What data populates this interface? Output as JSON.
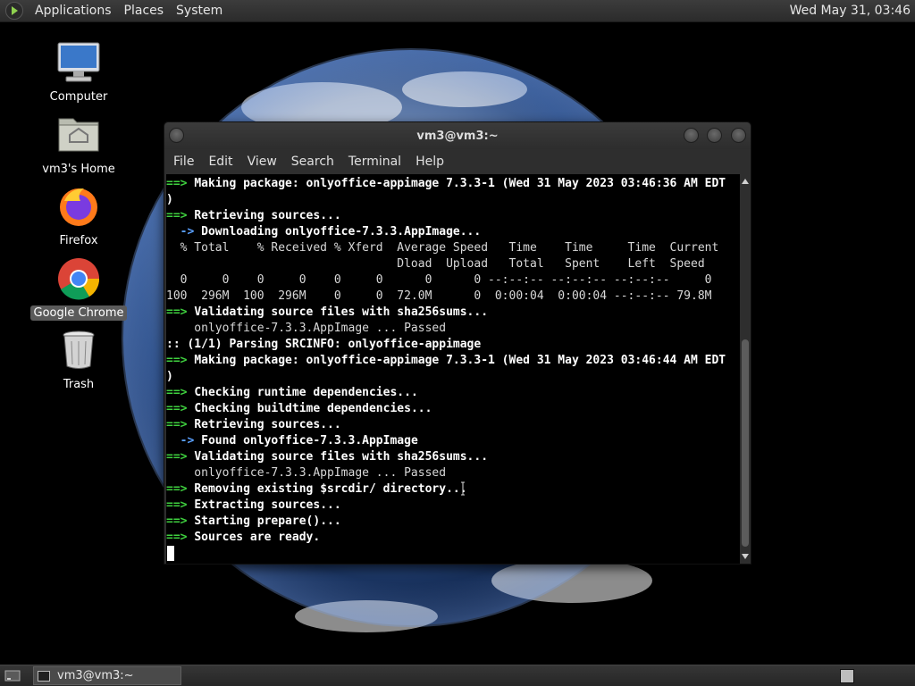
{
  "top_panel": {
    "menus": [
      "Applications",
      "Places",
      "System"
    ],
    "clock": "Wed May 31, 03:46"
  },
  "desktop_icons": [
    {
      "label": "Computer",
      "icon": "computer-icon"
    },
    {
      "label": "vm3's Home",
      "icon": "home-folder-icon"
    },
    {
      "label": "Firefox",
      "icon": "firefox-icon"
    },
    {
      "label": "Google Chrome",
      "icon": "chrome-icon",
      "selected": true
    },
    {
      "label": "Trash",
      "icon": "trash-icon"
    }
  ],
  "window": {
    "title": "vm3@vm3:~",
    "menus": [
      "File",
      "Edit",
      "View",
      "Search",
      "Terminal",
      "Help"
    ]
  },
  "terminal": {
    "lines": [
      {
        "prefix": "==> ",
        "prefix_style": "green",
        "text": "Making package: onlyoffice-appimage 7.3.3-1 (Wed 31 May 2023 03:46:36 AM EDT",
        "bold": true
      },
      {
        "prefix": "",
        "prefix_style": "",
        "text": ")",
        "bold": true
      },
      {
        "prefix": "==> ",
        "prefix_style": "green",
        "text": "Retrieving sources...",
        "bold": true
      },
      {
        "prefix": "  -> ",
        "prefix_style": "blue",
        "text": "Downloading onlyoffice-7.3.3.AppImage...",
        "bold": true
      },
      {
        "prefix": "",
        "prefix_style": "",
        "text": "  % Total    % Received % Xferd  Average Speed   Time    Time     Time  Current",
        "bold": false
      },
      {
        "prefix": "",
        "prefix_style": "",
        "text": "                                 Dload  Upload   Total   Spent    Left  Speed",
        "bold": false
      },
      {
        "prefix": "",
        "prefix_style": "",
        "text": "  0     0    0     0    0     0      0      0 --:--:-- --:--:-- --:--:--     0",
        "bold": false
      },
      {
        "prefix": "",
        "prefix_style": "",
        "text": "100  296M  100  296M    0     0  72.0M      0  0:00:04  0:00:04 --:--:-- 79.8M",
        "bold": false
      },
      {
        "prefix": "==> ",
        "prefix_style": "green",
        "text": "Validating source files with sha256sums...",
        "bold": true
      },
      {
        "prefix": "",
        "prefix_style": "",
        "text": "    onlyoffice-7.3.3.AppImage ... Passed",
        "bold": false
      },
      {
        "prefix": ":: ",
        "prefix_style": "plain",
        "text": "(1/1) Parsing SRCINFO: onlyoffice-appimage",
        "bold": true
      },
      {
        "prefix": "==> ",
        "prefix_style": "green",
        "text": "Making package: onlyoffice-appimage 7.3.3-1 (Wed 31 May 2023 03:46:44 AM EDT",
        "bold": true
      },
      {
        "prefix": "",
        "prefix_style": "",
        "text": ")",
        "bold": true
      },
      {
        "prefix": "==> ",
        "prefix_style": "green",
        "text": "Checking runtime dependencies...",
        "bold": true
      },
      {
        "prefix": "==> ",
        "prefix_style": "green",
        "text": "Checking buildtime dependencies...",
        "bold": true
      },
      {
        "prefix": "==> ",
        "prefix_style": "green",
        "text": "Retrieving sources...",
        "bold": true
      },
      {
        "prefix": "  -> ",
        "prefix_style": "blue",
        "text": "Found onlyoffice-7.3.3.AppImage",
        "bold": true
      },
      {
        "prefix": "==> ",
        "prefix_style": "green",
        "text": "Validating source files with sha256sums...",
        "bold": true
      },
      {
        "prefix": "",
        "prefix_style": "",
        "text": "    onlyoffice-7.3.3.AppImage ... Passed",
        "bold": false
      },
      {
        "prefix": "==> ",
        "prefix_style": "green",
        "text": "Removing existing $srcdir/ directory...",
        "bold": true
      },
      {
        "prefix": "==> ",
        "prefix_style": "green",
        "text": "Extracting sources...",
        "bold": true
      },
      {
        "prefix": "==> ",
        "prefix_style": "green",
        "text": "Starting prepare()...",
        "bold": true
      },
      {
        "prefix": "==> ",
        "prefix_style": "green",
        "text": "Sources are ready.",
        "bold": true
      }
    ]
  },
  "taskbar": {
    "task_label": "vm3@vm3:~"
  },
  "colors": {
    "prompt_green": "#3fd13f",
    "prompt_blue": "#5aa0ff",
    "terminal_bg": "#000000",
    "panel_bg": "#2e2e2e"
  }
}
